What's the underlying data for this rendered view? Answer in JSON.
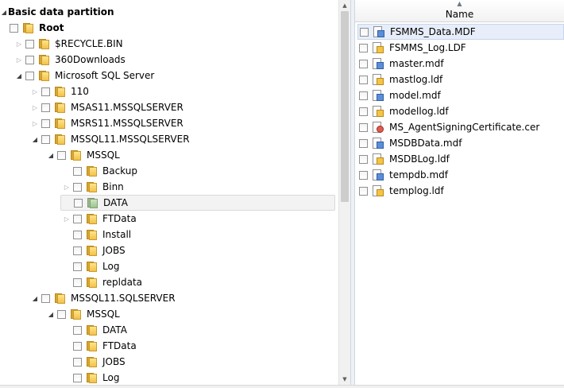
{
  "tree": {
    "header": "Basic data partition",
    "rows": [
      {
        "label": "Root",
        "bold": true,
        "expander": "none",
        "color": "yellow"
      },
      {
        "label": "$RECYCLE.BIN",
        "expander": "collapsed",
        "color": "yellow"
      },
      {
        "label": "360Downloads",
        "expander": "collapsed",
        "color": "yellow"
      },
      {
        "label": "Microsoft SQL Server",
        "expander": "expanded",
        "color": "yellow"
      },
      {
        "label": "110",
        "expander": "collapsed",
        "color": "yellow"
      },
      {
        "label": "MSAS11.MSSQLSERVER",
        "expander": "collapsed",
        "color": "yellow"
      },
      {
        "label": "MSRS11.MSSQLSERVER",
        "expander": "collapsed",
        "color": "yellow"
      },
      {
        "label": "MSSQL11.MSSQLSERVER",
        "expander": "expanded",
        "color": "yellow"
      },
      {
        "label": "MSSQL",
        "expander": "expanded",
        "color": "yellow"
      },
      {
        "label": "Backup",
        "expander": "none",
        "color": "yellow"
      },
      {
        "label": "Binn",
        "expander": "collapsed",
        "color": "yellow"
      },
      {
        "label": "DATA",
        "expander": "none",
        "color": "green",
        "selected": true
      },
      {
        "label": "FTData",
        "expander": "collapsed",
        "color": "yellow"
      },
      {
        "label": "Install",
        "expander": "none",
        "color": "yellow"
      },
      {
        "label": "JOBS",
        "expander": "none",
        "color": "yellow"
      },
      {
        "label": "Log",
        "expander": "none",
        "color": "yellow"
      },
      {
        "label": "repldata",
        "expander": "none",
        "color": "yellow"
      },
      {
        "label": "MSSQL11.SQLSERVER",
        "expander": "expanded",
        "color": "yellow"
      },
      {
        "label": "MSSQL",
        "expander": "expanded",
        "color": "yellow"
      },
      {
        "label": "DATA",
        "expander": "none",
        "color": "yellow"
      },
      {
        "label": "FTData",
        "expander": "none",
        "color": "yellow"
      },
      {
        "label": "JOBS",
        "expander": "none",
        "color": "yellow"
      },
      {
        "label": "Log",
        "expander": "none",
        "color": "yellow"
      }
    ]
  },
  "files": {
    "column_header": "Name",
    "sort_indicator": "▲",
    "items": [
      {
        "name": "FSMMS_Data.MDF",
        "icon": "blue",
        "highlight": true
      },
      {
        "name": "FSMMS_Log.LDF",
        "icon": "yellow"
      },
      {
        "name": "master.mdf",
        "icon": "blue"
      },
      {
        "name": "mastlog.ldf",
        "icon": "yellow"
      },
      {
        "name": "model.mdf",
        "icon": "blue"
      },
      {
        "name": "modellog.ldf",
        "icon": "yellow"
      },
      {
        "name": "MS_AgentSigningCertificate.cer",
        "icon": "cert"
      },
      {
        "name": "MSDBData.mdf",
        "icon": "blue"
      },
      {
        "name": "MSDBLog.ldf",
        "icon": "yellow"
      },
      {
        "name": "tempdb.mdf",
        "icon": "blue"
      },
      {
        "name": "templog.ldf",
        "icon": "yellow"
      }
    ]
  },
  "scrollbar": {
    "up": "▲",
    "down": "▼"
  },
  "glyphs": {
    "expanded": "◢",
    "collapsed": "▷"
  }
}
